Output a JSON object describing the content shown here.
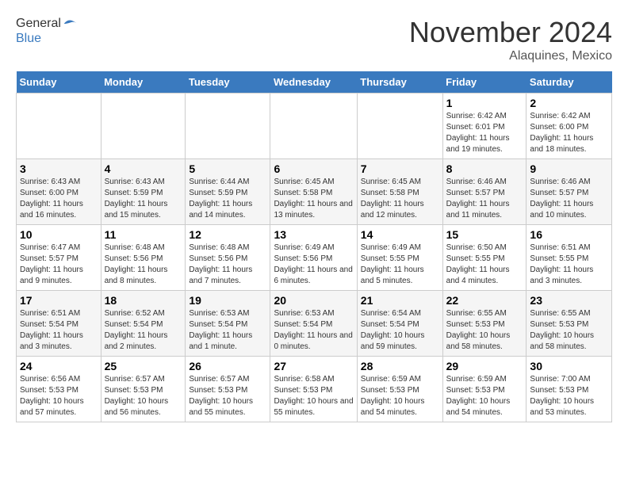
{
  "logo": {
    "general": "General",
    "blue": "Blue"
  },
  "title": "November 2024",
  "location": "Alaquines, Mexico",
  "days_of_week": [
    "Sunday",
    "Monday",
    "Tuesday",
    "Wednesday",
    "Thursday",
    "Friday",
    "Saturday"
  ],
  "weeks": [
    [
      {
        "day": "",
        "info": ""
      },
      {
        "day": "",
        "info": ""
      },
      {
        "day": "",
        "info": ""
      },
      {
        "day": "",
        "info": ""
      },
      {
        "day": "",
        "info": ""
      },
      {
        "day": "1",
        "info": "Sunrise: 6:42 AM\nSunset: 6:01 PM\nDaylight: 11 hours and 19 minutes."
      },
      {
        "day": "2",
        "info": "Sunrise: 6:42 AM\nSunset: 6:00 PM\nDaylight: 11 hours and 18 minutes."
      }
    ],
    [
      {
        "day": "3",
        "info": "Sunrise: 6:43 AM\nSunset: 6:00 PM\nDaylight: 11 hours and 16 minutes."
      },
      {
        "day": "4",
        "info": "Sunrise: 6:43 AM\nSunset: 5:59 PM\nDaylight: 11 hours and 15 minutes."
      },
      {
        "day": "5",
        "info": "Sunrise: 6:44 AM\nSunset: 5:59 PM\nDaylight: 11 hours and 14 minutes."
      },
      {
        "day": "6",
        "info": "Sunrise: 6:45 AM\nSunset: 5:58 PM\nDaylight: 11 hours and 13 minutes."
      },
      {
        "day": "7",
        "info": "Sunrise: 6:45 AM\nSunset: 5:58 PM\nDaylight: 11 hours and 12 minutes."
      },
      {
        "day": "8",
        "info": "Sunrise: 6:46 AM\nSunset: 5:57 PM\nDaylight: 11 hours and 11 minutes."
      },
      {
        "day": "9",
        "info": "Sunrise: 6:46 AM\nSunset: 5:57 PM\nDaylight: 11 hours and 10 minutes."
      }
    ],
    [
      {
        "day": "10",
        "info": "Sunrise: 6:47 AM\nSunset: 5:57 PM\nDaylight: 11 hours and 9 minutes."
      },
      {
        "day": "11",
        "info": "Sunrise: 6:48 AM\nSunset: 5:56 PM\nDaylight: 11 hours and 8 minutes."
      },
      {
        "day": "12",
        "info": "Sunrise: 6:48 AM\nSunset: 5:56 PM\nDaylight: 11 hours and 7 minutes."
      },
      {
        "day": "13",
        "info": "Sunrise: 6:49 AM\nSunset: 5:56 PM\nDaylight: 11 hours and 6 minutes."
      },
      {
        "day": "14",
        "info": "Sunrise: 6:49 AM\nSunset: 5:55 PM\nDaylight: 11 hours and 5 minutes."
      },
      {
        "day": "15",
        "info": "Sunrise: 6:50 AM\nSunset: 5:55 PM\nDaylight: 11 hours and 4 minutes."
      },
      {
        "day": "16",
        "info": "Sunrise: 6:51 AM\nSunset: 5:55 PM\nDaylight: 11 hours and 3 minutes."
      }
    ],
    [
      {
        "day": "17",
        "info": "Sunrise: 6:51 AM\nSunset: 5:54 PM\nDaylight: 11 hours and 3 minutes."
      },
      {
        "day": "18",
        "info": "Sunrise: 6:52 AM\nSunset: 5:54 PM\nDaylight: 11 hours and 2 minutes."
      },
      {
        "day": "19",
        "info": "Sunrise: 6:53 AM\nSunset: 5:54 PM\nDaylight: 11 hours and 1 minute."
      },
      {
        "day": "20",
        "info": "Sunrise: 6:53 AM\nSunset: 5:54 PM\nDaylight: 11 hours and 0 minutes."
      },
      {
        "day": "21",
        "info": "Sunrise: 6:54 AM\nSunset: 5:54 PM\nDaylight: 10 hours and 59 minutes."
      },
      {
        "day": "22",
        "info": "Sunrise: 6:55 AM\nSunset: 5:53 PM\nDaylight: 10 hours and 58 minutes."
      },
      {
        "day": "23",
        "info": "Sunrise: 6:55 AM\nSunset: 5:53 PM\nDaylight: 10 hours and 58 minutes."
      }
    ],
    [
      {
        "day": "24",
        "info": "Sunrise: 6:56 AM\nSunset: 5:53 PM\nDaylight: 10 hours and 57 minutes."
      },
      {
        "day": "25",
        "info": "Sunrise: 6:57 AM\nSunset: 5:53 PM\nDaylight: 10 hours and 56 minutes."
      },
      {
        "day": "26",
        "info": "Sunrise: 6:57 AM\nSunset: 5:53 PM\nDaylight: 10 hours and 55 minutes."
      },
      {
        "day": "27",
        "info": "Sunrise: 6:58 AM\nSunset: 5:53 PM\nDaylight: 10 hours and 55 minutes."
      },
      {
        "day": "28",
        "info": "Sunrise: 6:59 AM\nSunset: 5:53 PM\nDaylight: 10 hours and 54 minutes."
      },
      {
        "day": "29",
        "info": "Sunrise: 6:59 AM\nSunset: 5:53 PM\nDaylight: 10 hours and 54 minutes."
      },
      {
        "day": "30",
        "info": "Sunrise: 7:00 AM\nSunset: 5:53 PM\nDaylight: 10 hours and 53 minutes."
      }
    ]
  ]
}
